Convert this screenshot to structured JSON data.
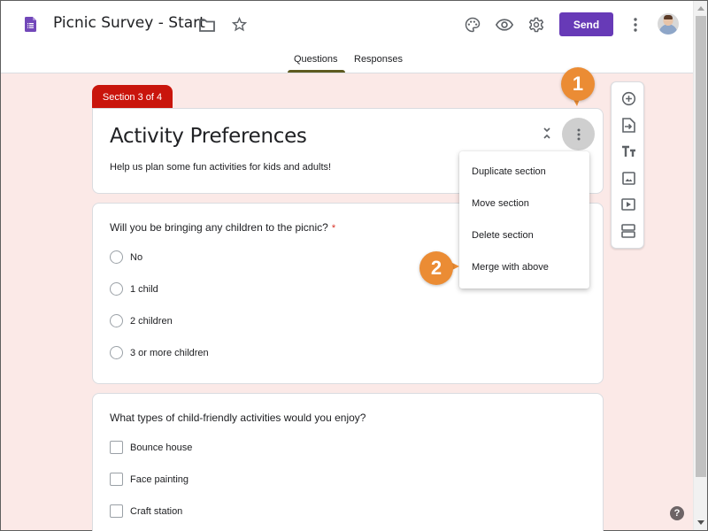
{
  "app": {
    "doc_title": "Picnic Survey - Start",
    "send_label": "Send",
    "brand_color": "#673ab7"
  },
  "tabs": [
    {
      "label": "Questions",
      "active": true
    },
    {
      "label": "Responses",
      "active": false
    }
  ],
  "section": {
    "badge": "Section 3 of 4",
    "title": "Activity Preferences",
    "description": "Help us plan some fun activities for kids and adults!",
    "badge_color": "#c9150c"
  },
  "section_menu": {
    "items": [
      {
        "label": "Duplicate section"
      },
      {
        "label": "Move section"
      },
      {
        "label": "Delete section"
      },
      {
        "label": "Merge with above"
      }
    ]
  },
  "questions": [
    {
      "title": "Will you be bringing any children to the picnic?",
      "required_mark": "*",
      "type": "radio",
      "options": [
        "No",
        "1 child",
        "2 children",
        "3 or more children"
      ]
    },
    {
      "title": "What types of child-friendly activities would you enjoy?",
      "type": "checkbox",
      "options": [
        "Bounce house",
        "Face painting",
        "Craft station"
      ]
    }
  ],
  "side_toolbar": {
    "tools": [
      "add-question",
      "import-questions",
      "add-title",
      "add-image",
      "add-video",
      "add-section"
    ]
  },
  "callouts": {
    "one": "1",
    "two": "2",
    "color": "#eb8c34"
  },
  "help": {
    "label": "?"
  }
}
